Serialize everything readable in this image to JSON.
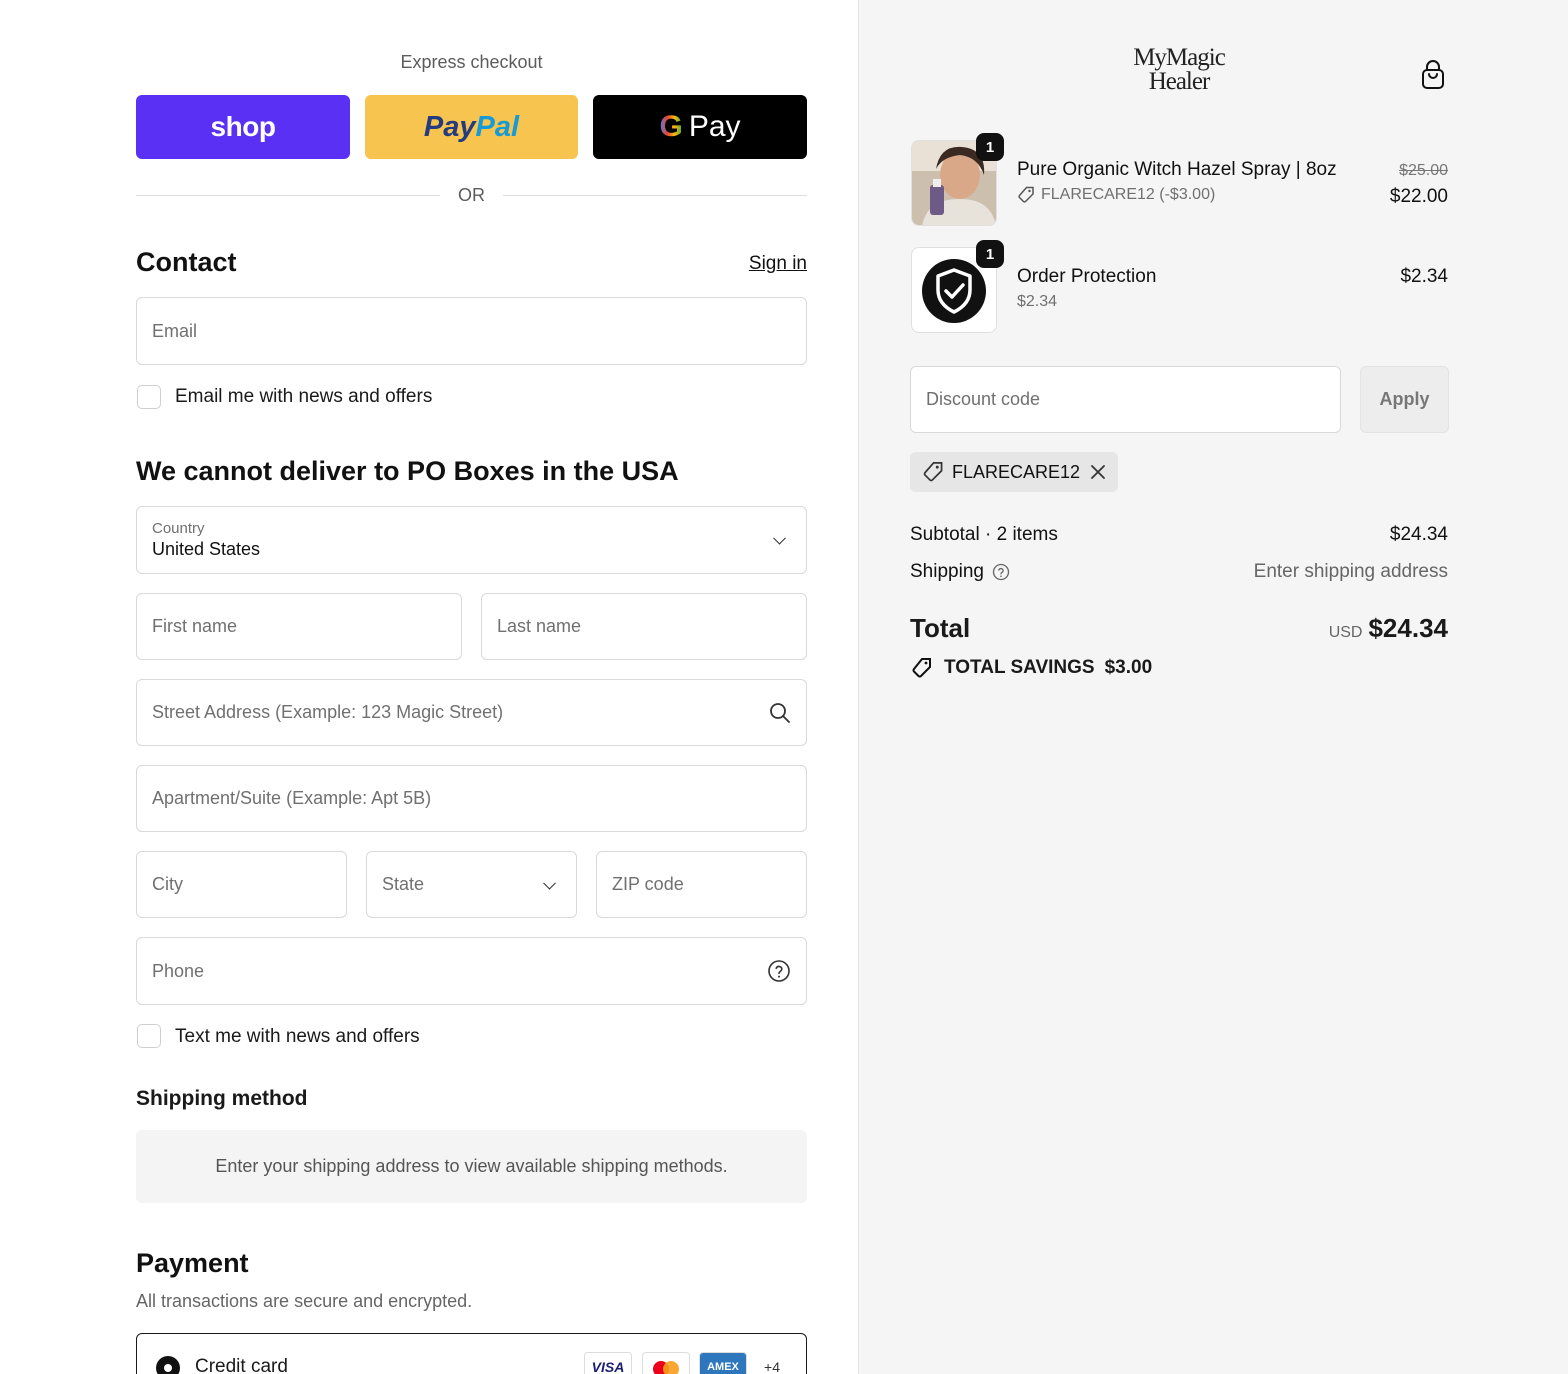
{
  "express": {
    "title": "Express checkout",
    "shop_label": "shop",
    "paypal_part1": "Pay",
    "paypal_part2": "Pal",
    "gpay_g": "G",
    "gpay_label": "Pay",
    "or_label": "OR"
  },
  "contact": {
    "heading": "Contact",
    "signin": "Sign in",
    "email_placeholder": "Email",
    "email_opt_label": "Email me with news and offers"
  },
  "delivery": {
    "heading": "We cannot deliver to PO Boxes in the USA",
    "country_label": "Country",
    "country_value": "United States",
    "first_name": "First name",
    "last_name": "Last name",
    "street": "Street Address (Example: 123 Magic Street)",
    "apartment": "Apartment/Suite (Example: Apt 5B)",
    "city": "City",
    "state": "State",
    "zip": "ZIP code",
    "phone": "Phone",
    "text_opt_label": "Text me with news and offers"
  },
  "shipping_method": {
    "heading": "Shipping method",
    "info": "Enter your shipping address to view available shipping methods."
  },
  "payment": {
    "heading": "Payment",
    "subtitle": "All transactions are secure and encrypted.",
    "credit_card_label": "Credit card",
    "card_visa": "VISA",
    "card_amex": "AMEX",
    "card_more": "+4"
  },
  "brand": {
    "line1": "MyMagic",
    "line2": "Healer"
  },
  "cart": {
    "items": [
      {
        "name": "Pure Organic Witch Hazel Spray | 8oz",
        "qty": "1",
        "discount": "FLARECARE12 (-$3.00)",
        "original_price": "$25.00",
        "price": "$22.00"
      },
      {
        "name": "Order Protection",
        "qty": "1",
        "sub": "$2.34",
        "price": "$2.34"
      }
    ],
    "discount_placeholder": "Discount code",
    "apply_label": "Apply",
    "applied_code": "FLARECARE12",
    "subtotal_label": "Subtotal · 2 items",
    "subtotal_value": "$24.34",
    "shipping_label": "Shipping",
    "shipping_value": "Enter shipping address",
    "total_label": "Total",
    "currency": "USD",
    "total_value": "$24.34",
    "savings_label": "TOTAL SAVINGS",
    "savings_value": "$3.00"
  },
  "colors": {
    "shop_purple": "#5a31f4",
    "paypal_yellow": "#f7c44f",
    "gpay_black": "#000000",
    "summary_bg": "#f5f5f5"
  }
}
